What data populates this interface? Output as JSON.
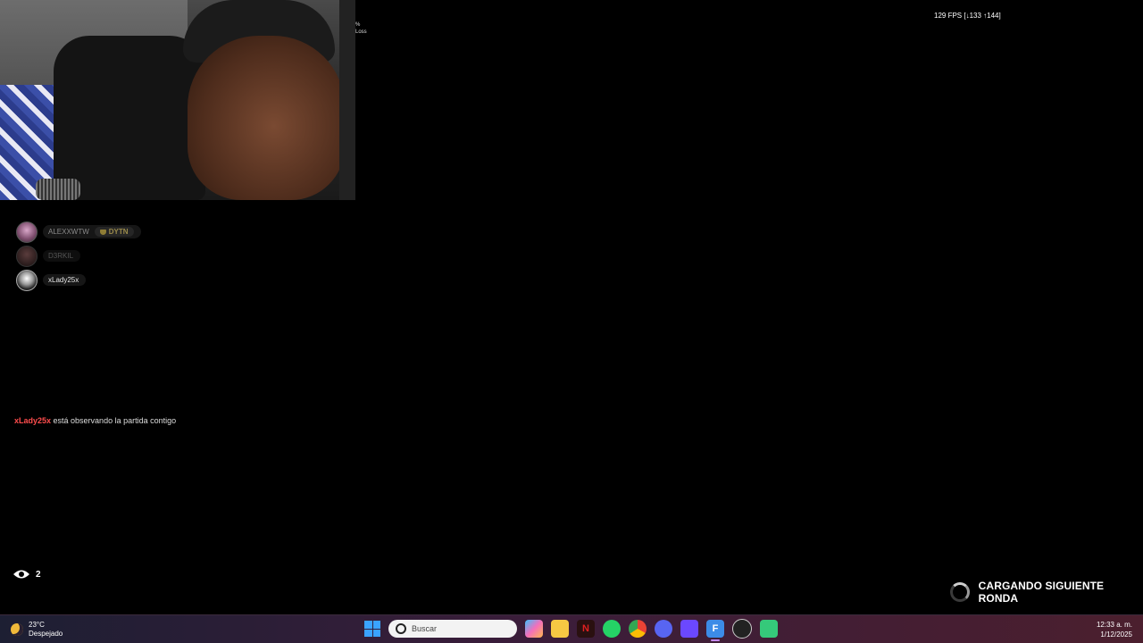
{
  "overlay": {
    "fps": "129 FPS [↓133 ↑144]",
    "corner_text_1": "%",
    "corner_text_2": "Loss"
  },
  "party": [
    {
      "name": "ALEXXWTW",
      "tag": "DYTN"
    },
    {
      "name": "D3RKIL"
    },
    {
      "name": "xLady25x"
    }
  ],
  "notice": {
    "player": "xLady25x",
    "message": " está observando la partida contigo"
  },
  "spectators": {
    "count": "2",
    "icon": "eye-icon"
  },
  "status": {
    "loading": "CARGANDO SIGUIENTE RONDA"
  },
  "taskbar": {
    "weather_temp": "23°C",
    "weather_desc": "Despejado",
    "search_placeholder": "Buscar",
    "apps": [
      "copilot",
      "file-explorer",
      "red-app",
      "whatsapp",
      "chrome",
      "discord",
      "streaming-app",
      "fortnite",
      "obs",
      "cursor-app"
    ],
    "time": "12:33 a. m.",
    "date": "1/12/2025"
  },
  "colors": {
    "notice_name": "#ff4d4d",
    "taskbar_accent": "#c58af9"
  }
}
